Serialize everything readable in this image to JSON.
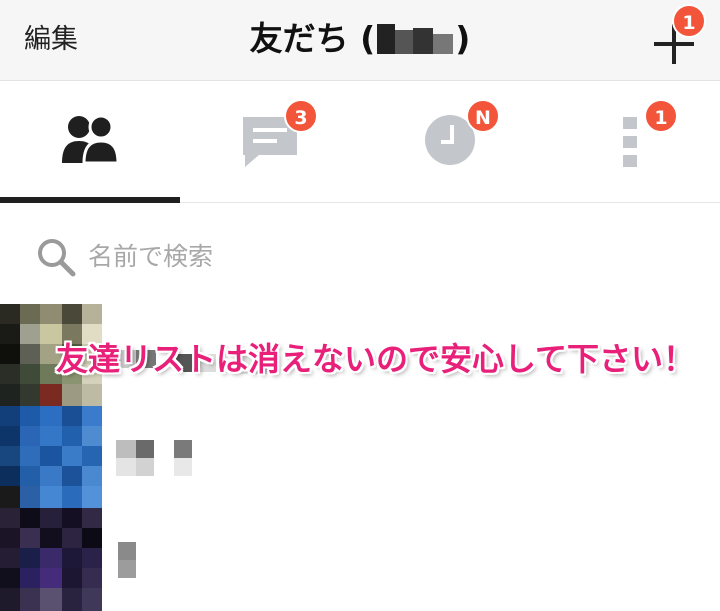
{
  "header": {
    "edit_label": "編集",
    "title": "友だち (",
    "title_close": ")",
    "add_badge": "1"
  },
  "tabs": [
    {
      "name": "friends",
      "icon": "friends-icon",
      "badge": ""
    },
    {
      "name": "chats",
      "icon": "chat-icon",
      "badge": "3"
    },
    {
      "name": "timeline",
      "icon": "clock-icon",
      "badge": "N"
    },
    {
      "name": "more",
      "icon": "more-icon",
      "badge": "1"
    }
  ],
  "search": {
    "placeholder": "名前で検索"
  },
  "annotation": "友達リストは消えないので安心して下さい！",
  "colors": {
    "badge": "#f2553a",
    "annotation": "#e8207a",
    "icon_gray": "#c3c7cc",
    "active_icon": "#1f1f1f"
  }
}
